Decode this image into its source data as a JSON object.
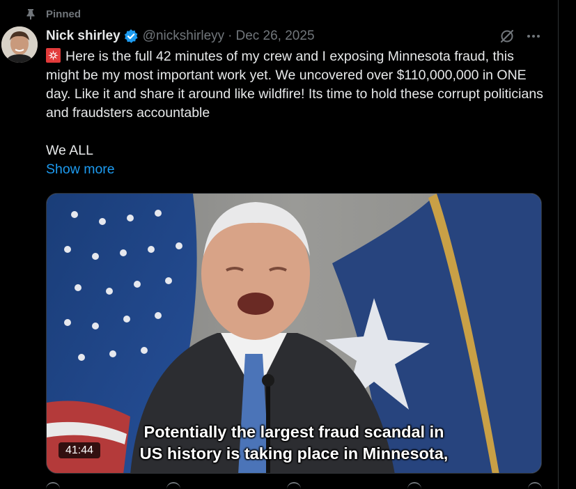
{
  "pinned_label": "Pinned",
  "author": {
    "name": "Nick shirley",
    "handle": "@nickshirleyy",
    "separator": "·",
    "date": "Dec 26, 2025"
  },
  "tweet": {
    "line1": "Here is the full 42 minutes of my crew and I exposing Minnesota fraud, this might be my most important work yet. We uncovered over $110,000,000 in ONE day. Like it and share it around like wildfire! Its time to hold these corrupt politicians and fraudsters accountable",
    "line2": "We ALL",
    "show_more": "Show more"
  },
  "video": {
    "caption_line1": "Potentially the largest fraud scandal in",
    "caption_line2": "US history is taking place in Minnesota,",
    "duration": "41:44"
  },
  "icons": {
    "pin": "pin-icon",
    "verified": "verified-badge-icon",
    "grok": "grok-icon",
    "more": "more-icon",
    "siren": "siren-emoji"
  },
  "colors": {
    "background": "#000000",
    "text": "#e7e9ea",
    "muted": "#71767b",
    "accent": "#1d9bf0"
  }
}
